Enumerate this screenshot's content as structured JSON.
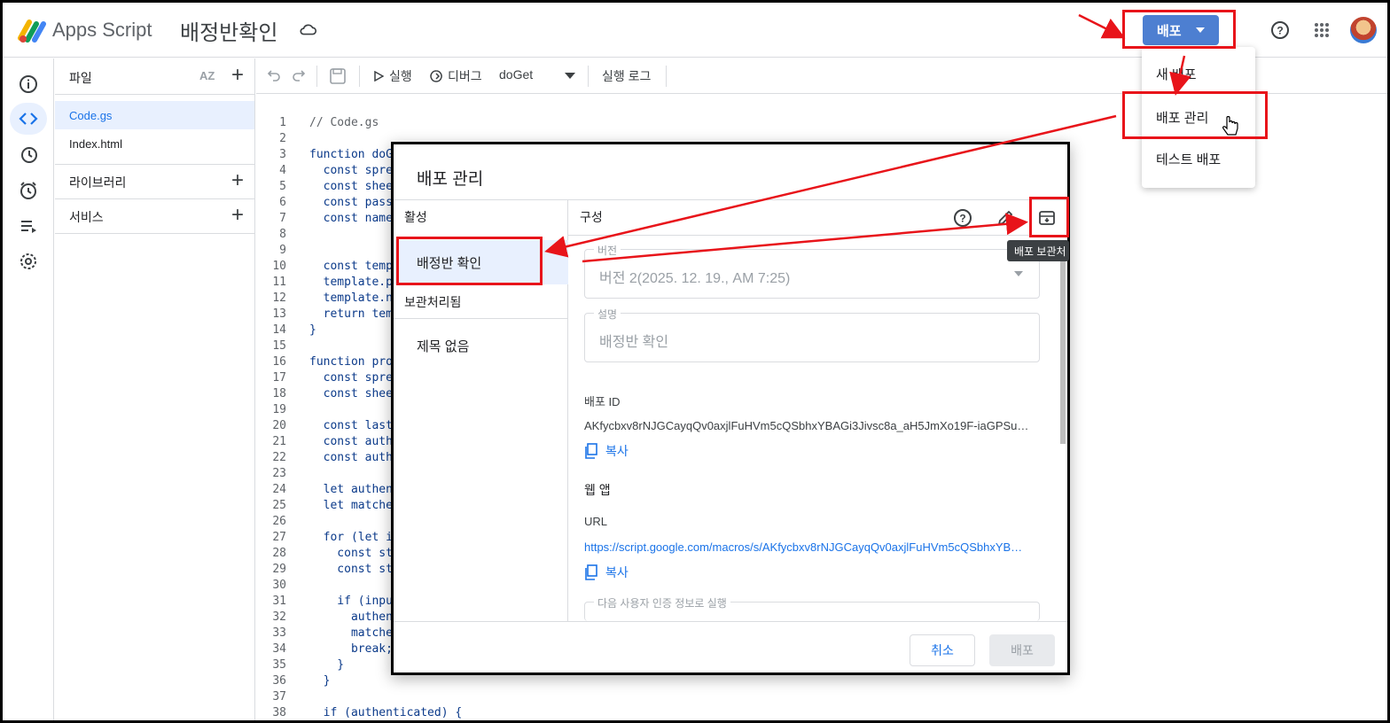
{
  "header": {
    "app_name": "Apps Script",
    "project_name": "배정반확인",
    "deploy_label": "배포"
  },
  "files_panel": {
    "files_title": "파일",
    "sort_label": "AZ",
    "files": [
      "Code.gs",
      "Index.html"
    ],
    "libraries_title": "라이브러리",
    "services_title": "서비스"
  },
  "toolbar": {
    "run_label": "실행",
    "debug_label": "디버그",
    "function_name": "doGet",
    "exec_log_label": "실행 로그"
  },
  "editor": {
    "line_numbers": [
      "1",
      "2",
      "3",
      "4",
      "5",
      "6",
      "7",
      "8",
      "9",
      "10",
      "11",
      "12",
      "13",
      "14",
      "15",
      "16",
      "17",
      "18",
      "19",
      "20",
      "21",
      "22",
      "23",
      "24",
      "25",
      "26",
      "27",
      "28",
      "29",
      "30",
      "31",
      "32",
      "33",
      "34",
      "35",
      "36",
      "37",
      "38"
    ],
    "lines": [
      "// Code.gs",
      "",
      "function doG",
      "  const spre",
      "  const shee",
      "  const pass",
      "  const name",
      "",
      "",
      "  const temp",
      "  template.p",
      "  template.n",
      "  return tem",
      "}",
      "",
      "function pro",
      "  const spre",
      "  const shee",
      "",
      "  const last",
      "  const auth",
      "  const auth",
      "",
      "  let authen",
      "  let matche",
      "",
      "  for (let i",
      "    const st",
      "    const st",
      "",
      "    if (inpu",
      "      authen",
      "      matche",
      "      break;",
      "    }",
      "  }",
      "",
      "  if (authenticated) {"
    ]
  },
  "modal": {
    "title": "배포 관리",
    "active_header": "활성",
    "active_item": "배정반 확인",
    "archived_header": "보관처리됨",
    "archived_item": "제목 없음",
    "config_header": "구성",
    "version_label": "버전",
    "version_value": "버전 2(2025. 12. 19., AM 7:25)",
    "description_label": "설명",
    "description_value": "배정반 확인",
    "deploy_id_label": "배포 ID",
    "deploy_id_value": "AKfycbxv8rNJGCayqQv0axjlFuHVm5cQSbhxYBAGi3Jivsc8a_aH5JmXo19F-iaGPSuS…",
    "copy_label": "복사",
    "webapp_label": "웹 앱",
    "url_label": "URL",
    "url_value": "https://script.google.com/macros/s/AKfycbxv8rNJGCayqQv0axjlFuHVm5cQSbhxYB…",
    "exec_as_label": "다음 사용자 인증 정보로 실행",
    "cancel_label": "취소",
    "deploy_label": "배포",
    "tooltip": "배포 보관처"
  },
  "menu": {
    "items": [
      "새 배포",
      "배포 관리",
      "테스트 배포"
    ]
  },
  "colors": {
    "accent": "#1a73e8",
    "deploy_button": "#4d7fd1",
    "highlight": "#e8141a",
    "active_bg": "#e8f0fe"
  }
}
